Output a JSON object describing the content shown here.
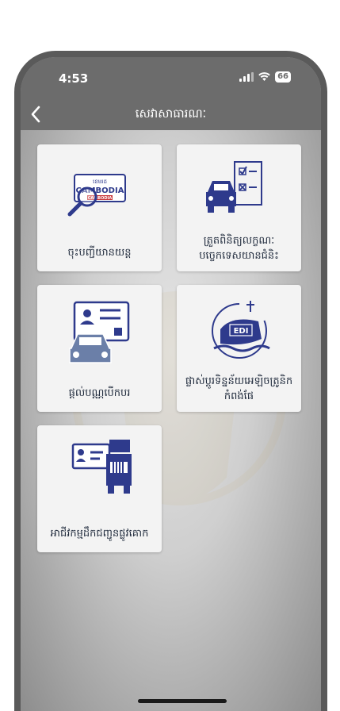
{
  "status_bar": {
    "time": "4:53",
    "battery": "66"
  },
  "nav": {
    "back_icon": "chevron-left-icon",
    "title": "សេវាសាធារណៈ"
  },
  "services": [
    {
      "label": "ចុះបញ្ជីយានយន្ត",
      "icon": "registration-plate-search-icon",
      "plate_top": "ខេមរដ",
      "plate_main": "CAMBODIA",
      "plate_sub": "CAMBODIA"
    },
    {
      "label": "ត្រួតពិនិត្យលក្ខណៈបច្ចេកទេសយានជំនិះ",
      "icon": "vehicle-inspection-checklist-icon"
    },
    {
      "label": "ផ្តល់បណ្ណបើកបរ",
      "icon": "driving-license-icon"
    },
    {
      "label": "ផ្លាស់ប្តូរទិន្នន័យអេឡិចត្រូនិកកំពង់ផែ",
      "icon": "port-edi-ship-icon",
      "badge": "EDI"
    },
    {
      "label": "អាជីវកម្មដឹកជញ្ជូនផ្លូវគោក",
      "icon": "road-transport-truck-icon"
    }
  ],
  "colors": {
    "accent": "#2e3a8c",
    "nav_bg": "#6c6c6c",
    "card_bg": "#f3f3f3"
  }
}
